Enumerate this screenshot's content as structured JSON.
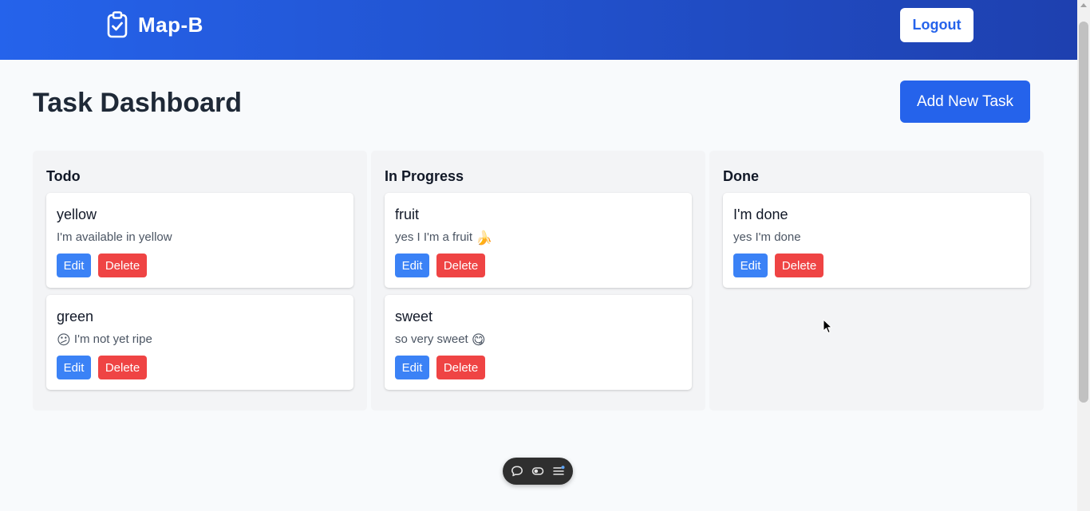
{
  "app": {
    "name": "Map-B",
    "logo_icon": "clipboard-check-icon"
  },
  "header": {
    "logout_label": "Logout"
  },
  "page": {
    "title": "Task Dashboard",
    "add_button_label": "Add New Task"
  },
  "colors": {
    "header_gradient_start": "#2563eb",
    "header_gradient_end": "#1e40af",
    "primary": "#2563eb",
    "edit_button": "#3b82f6",
    "delete_button": "#ef4444",
    "column_bg": "#f3f4f6",
    "page_bg": "#f8fafc"
  },
  "columns": [
    {
      "title": "Todo",
      "tasks": [
        {
          "title": "yellow",
          "description": "I'm available in yellow",
          "emoji": "",
          "edit_label": "Edit",
          "delete_label": "Delete"
        },
        {
          "title": "green",
          "description": "I'm not yet ripe",
          "emoji": "😕",
          "edit_label": "Edit",
          "delete_label": "Delete"
        }
      ]
    },
    {
      "title": "In Progress",
      "tasks": [
        {
          "title": "fruit",
          "description": "yes I I'm a fruit",
          "emoji": "🍌",
          "edit_label": "Edit",
          "delete_label": "Delete"
        },
        {
          "title": "sweet",
          "description": "so very sweet",
          "emoji": "😋",
          "edit_label": "Edit",
          "delete_label": "Delete"
        }
      ]
    },
    {
      "title": "Done",
      "tasks": [
        {
          "title": "I'm done",
          "description": "yes I'm done",
          "emoji": "",
          "edit_label": "Edit",
          "delete_label": "Delete"
        }
      ]
    }
  ],
  "floating_toolbar": {
    "icons": [
      "comment-icon",
      "toggle-icon",
      "menu-icon"
    ]
  }
}
